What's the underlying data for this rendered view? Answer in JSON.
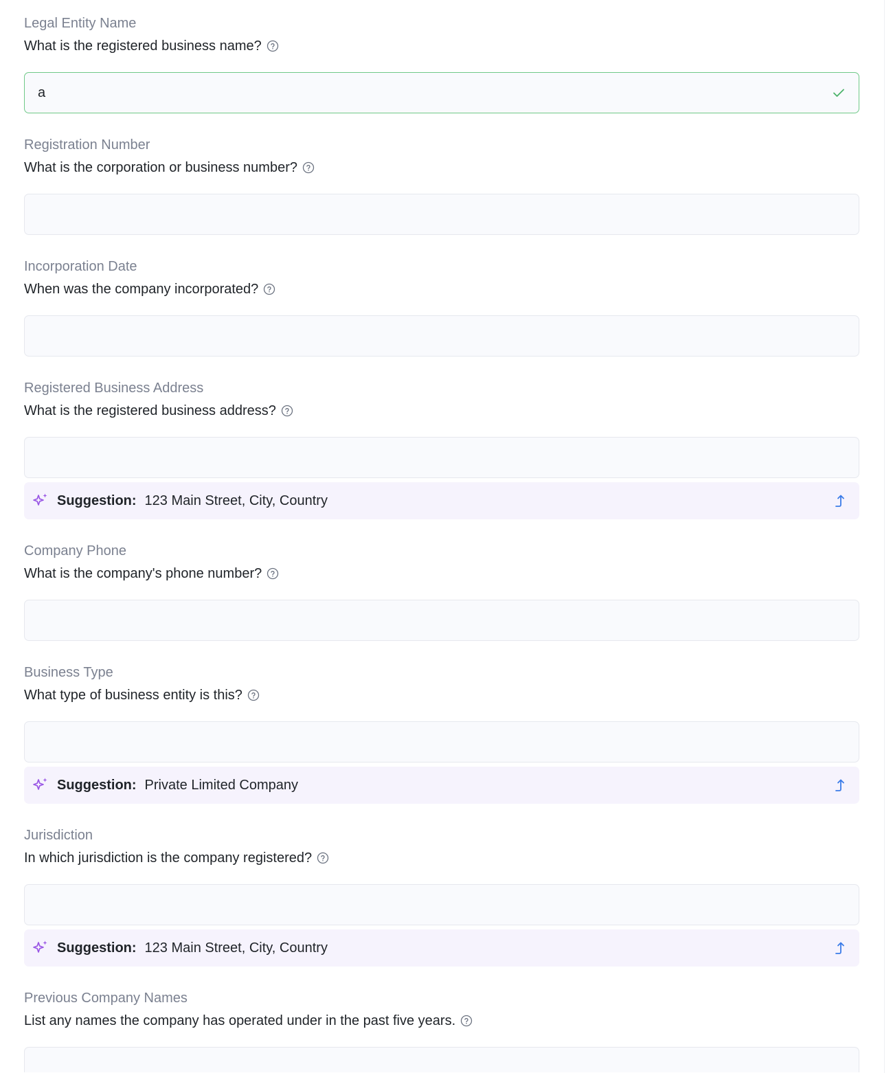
{
  "fields": [
    {
      "label": "Legal Entity Name",
      "question": "What is the registered business name?",
      "value": "a",
      "valid": true
    },
    {
      "label": "Registration Number",
      "question": "What is the corporation or business number?",
      "value": ""
    },
    {
      "label": "Incorporation Date",
      "question": "When was the company incorporated?",
      "value": ""
    },
    {
      "label": "Registered Business Address",
      "question": "What is the registered business address?",
      "value": "",
      "suggestion_label": "Suggestion:",
      "suggestion_value": "123 Main Street, City, Country"
    },
    {
      "label": "Company Phone",
      "question": "What is the company's phone number?",
      "value": ""
    },
    {
      "label": "Business Type",
      "question": "What type of business entity is this?",
      "value": "",
      "suggestion_label": "Suggestion:",
      "suggestion_value": "Private Limited Company"
    },
    {
      "label": "Jurisdiction",
      "question": "In which jurisdiction is the company registered?",
      "value": "",
      "suggestion_label": "Suggestion:",
      "suggestion_value": "123 Main Street, City, Country"
    },
    {
      "label": "Previous Company Names",
      "question": "List any names the company has operated under in the past five years.",
      "value": ""
    }
  ],
  "icons": {
    "help": "help-circle-icon",
    "valid": "check-icon",
    "suggestion": "sparkle-icon",
    "apply": "apply-arrow-icon"
  },
  "colors": {
    "label": "#7b8190",
    "valid_border": "#6fc987",
    "suggestion_bg": "#f6f3fd",
    "sparkle": "#9a57e5",
    "apply": "#3a7be8"
  }
}
